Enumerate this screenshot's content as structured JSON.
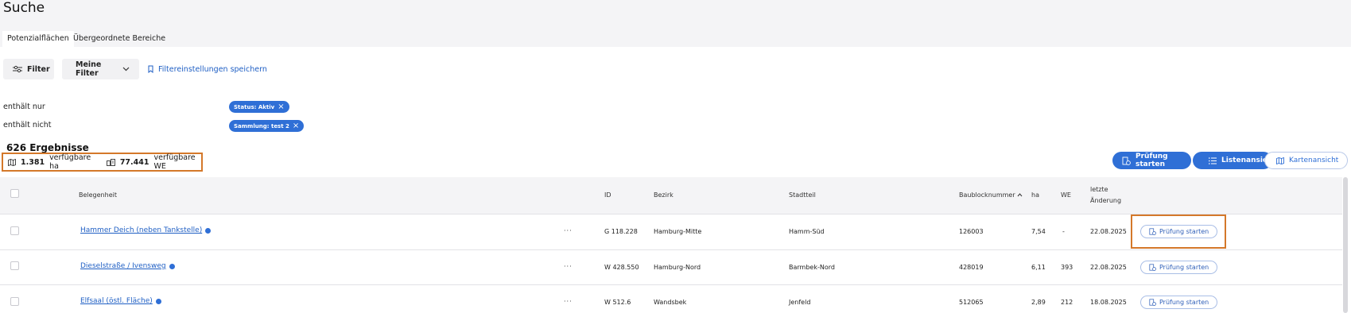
{
  "page": {
    "title": "Suche"
  },
  "tabs": [
    {
      "label": "Potenzialflächen",
      "active": true
    },
    {
      "label": "Übergeordnete Bereiche",
      "active": false
    }
  ],
  "toolbar": {
    "filter_label": "Filter",
    "my_filters_label": "Meine Filter",
    "save_filter_label": "Filtereinstellungen speichern"
  },
  "filters": {
    "include_label": "enthält nur",
    "exclude_label": "enthält nicht",
    "include_chip": "Status: Aktiv",
    "exclude_chip": "Sammlung: test 2"
  },
  "results": {
    "count_label": "626 Ergebnisse",
    "ha_value": "1.381",
    "ha_label": "verfügbare ha",
    "we_value": "77.441",
    "we_label": "verfügbare WE"
  },
  "actions": {
    "start_check_label": "Prüfung starten",
    "list_view_label": "Listenansicht",
    "map_view_label": "Kartenansicht"
  },
  "table": {
    "headers": {
      "location": "Belegenheit",
      "id": "ID",
      "district": "Bezirk",
      "quarter": "Stadtteil",
      "block": "Baublocknummer",
      "ha": "ha",
      "we": "WE",
      "changed_1": "letzte",
      "changed_2": "Änderung"
    },
    "more_icon_text": "···",
    "row_action_label": "Prüfung starten",
    "rows": [
      {
        "location": "Hammer Deich (neben Tankstelle)",
        "id": "G 118.228",
        "district": "Hamburg-Mitte",
        "quarter": "Hamm-Süd",
        "block": "126003",
        "ha": "7,54",
        "we": "-",
        "changed": "22.08.2025"
      },
      {
        "location": "Dieselstraße / Ivensweg",
        "id": "W 428.550",
        "district": "Hamburg-Nord",
        "quarter": "Barmbek-Nord",
        "block": "428019",
        "ha": "6,11",
        "we": "393",
        "changed": "22.08.2025"
      },
      {
        "location": "Elfsaal (östl. Fläche)",
        "id": "W 512.6",
        "district": "Wandsbek",
        "quarter": "Jenfeld",
        "block": "512065",
        "ha": "2,89",
        "we": "212",
        "changed": "18.08.2025"
      }
    ]
  },
  "colors": {
    "accent": "#2f6fd6",
    "highlight": "#d4782a"
  }
}
